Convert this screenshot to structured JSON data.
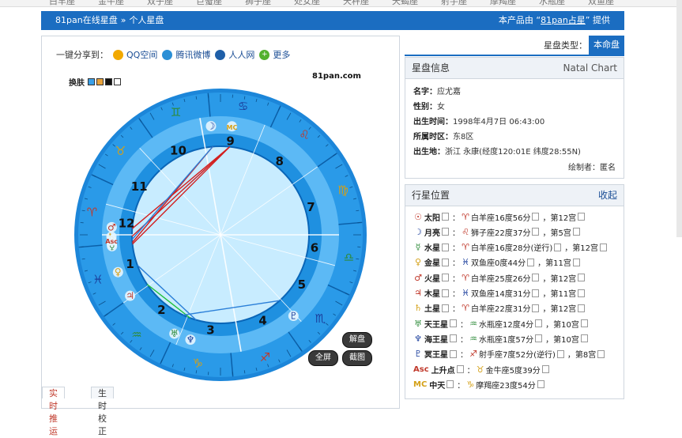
{
  "topnav": [
    "白羊座",
    "金牛座",
    "双子座",
    "巨蟹座",
    "狮子座",
    "处女座",
    "天秤座",
    "天蝎座",
    "射手座",
    "摩羯座",
    "水瓶座",
    "双鱼座"
  ],
  "breadcrumb": {
    "site": "81pan在线星盘",
    "sep": "»",
    "current": "个人星盘"
  },
  "provider": {
    "prefix": "本产品由 “",
    "link": "81pan占星",
    "suffix": "” 提供"
  },
  "share": {
    "label": "一键分享到：",
    "items": [
      {
        "name": "QQ空间",
        "icon": "qzone-icon",
        "color": "#f2a900"
      },
      {
        "name": "腾讯微博",
        "icon": "tencent-weibo-icon",
        "color": "#2b8fd6"
      },
      {
        "name": "人人网",
        "icon": "renren-icon",
        "color": "#1f5fa8"
      },
      {
        "name": "更多",
        "icon": "plus-icon",
        "color": "#53b12f"
      }
    ]
  },
  "skin": {
    "label": "换肤",
    "colors": [
      "#3aa0e8",
      "#e8a23a",
      "#111111",
      "#ffffff"
    ]
  },
  "brand": "81pan.com",
  "wheel": {
    "house_numbers": [
      "1",
      "2",
      "3",
      "4",
      "5",
      "6",
      "7",
      "8",
      "9",
      "10",
      "11",
      "12"
    ],
    "sign_glyphs": [
      "♈",
      "♉",
      "♊",
      "♋",
      "♌",
      "♍",
      "♎",
      "♏",
      "♐",
      "♑",
      "♒",
      "♓"
    ],
    "planet_glyphs": [
      "☉",
      "☽",
      "☿",
      "♀",
      "♂",
      "♃",
      "♄",
      "♅",
      "♆",
      "♇",
      "Asc",
      "MC"
    ]
  },
  "buttons": {
    "interpret": "解盘",
    "fullscreen": "全屏",
    "screenshot": "截图"
  },
  "tabs": [
    "实时推运",
    "生时校正"
  ],
  "chart_type": {
    "label": "星盘类型：",
    "value": "本命盘"
  },
  "info": {
    "title": "星盘信息",
    "title_en": "Natal Chart",
    "rows": [
      {
        "k": "名字：",
        "v": "应尤嘉"
      },
      {
        "k": "性别：",
        "v": "女"
      },
      {
        "k": "出生时间：",
        "v": "1998年4月7日  06:43:00"
      },
      {
        "k": "所属时区：",
        "v": "东8区"
      },
      {
        "k": "出生地：",
        "v": "浙江 永康(经度120:01E 纬度28:55N)"
      }
    ],
    "author": "绘制者：匿名"
  },
  "planets": {
    "title": "行星位置",
    "collapse": "收起",
    "rows": [
      {
        "glyph": "☉",
        "color": "#c0392b",
        "name": "太阳",
        "sglyph": "♈",
        "scolor": "#c0392b",
        "text": "白羊座16度56分",
        "house": "，第12宫"
      },
      {
        "glyph": "☽",
        "color": "#1b3e9c",
        "name": "月亮",
        "sglyph": "♌",
        "scolor": "#c0392b",
        "text": "狮子座22度37分",
        "house": "，第5宫"
      },
      {
        "glyph": "☿",
        "color": "#2e8b3a",
        "name": "水星",
        "sglyph": "♈",
        "scolor": "#c0392b",
        "text": "白羊座16度28分(逆行)",
        "house": "，第12宫"
      },
      {
        "glyph": "♀",
        "color": "#d4a017",
        "name": "金星",
        "sglyph": "♓",
        "scolor": "#1b3e9c",
        "text": "双鱼座0度44分",
        "house": "，第11宫"
      },
      {
        "glyph": "♂",
        "color": "#c0392b",
        "name": "火星",
        "sglyph": "♈",
        "scolor": "#c0392b",
        "text": "白羊座25度26分",
        "house": "，第12宫"
      },
      {
        "glyph": "♃",
        "color": "#c0392b",
        "name": "木星",
        "sglyph": "♓",
        "scolor": "#1b3e9c",
        "text": "双鱼座14度31分",
        "house": "，第11宫"
      },
      {
        "glyph": "♄",
        "color": "#d4a017",
        "name": "土星",
        "sglyph": "♈",
        "scolor": "#c0392b",
        "text": "白羊座22度31分",
        "house": "，第12宫"
      },
      {
        "glyph": "♅",
        "color": "#2e8b3a",
        "name": "天王星",
        "sglyph": "♒",
        "scolor": "#2e8b3a",
        "text": "水瓶座12度4分",
        "house": "，第10宫"
      },
      {
        "glyph": "♆",
        "color": "#1b3e9c",
        "name": "海王星",
        "sglyph": "♒",
        "scolor": "#2e8b3a",
        "text": "水瓶座1度57分",
        "house": "，第10宫"
      },
      {
        "glyph": "♇",
        "color": "#1b3e9c",
        "name": "冥王星",
        "sglyph": "♐",
        "scolor": "#c0392b",
        "text": "射手座7度52分(逆行)",
        "house": "，第8宫"
      },
      {
        "glyph": "Asc",
        "color": "#c0392b",
        "name": "上升点",
        "sglyph": "♉",
        "scolor": "#d4a017",
        "text": "金牛座5度39分",
        "house": ""
      },
      {
        "glyph": "MC",
        "color": "#d4a017",
        "name": "中天",
        "sglyph": "♑",
        "scolor": "#d4a017",
        "text": "摩羯座23度54分",
        "house": ""
      }
    ]
  },
  "colors": {
    "accent": "#1b6dc1",
    "wheel_outer": "#1e8fe0",
    "wheel_inner": "#bfe6ff"
  }
}
